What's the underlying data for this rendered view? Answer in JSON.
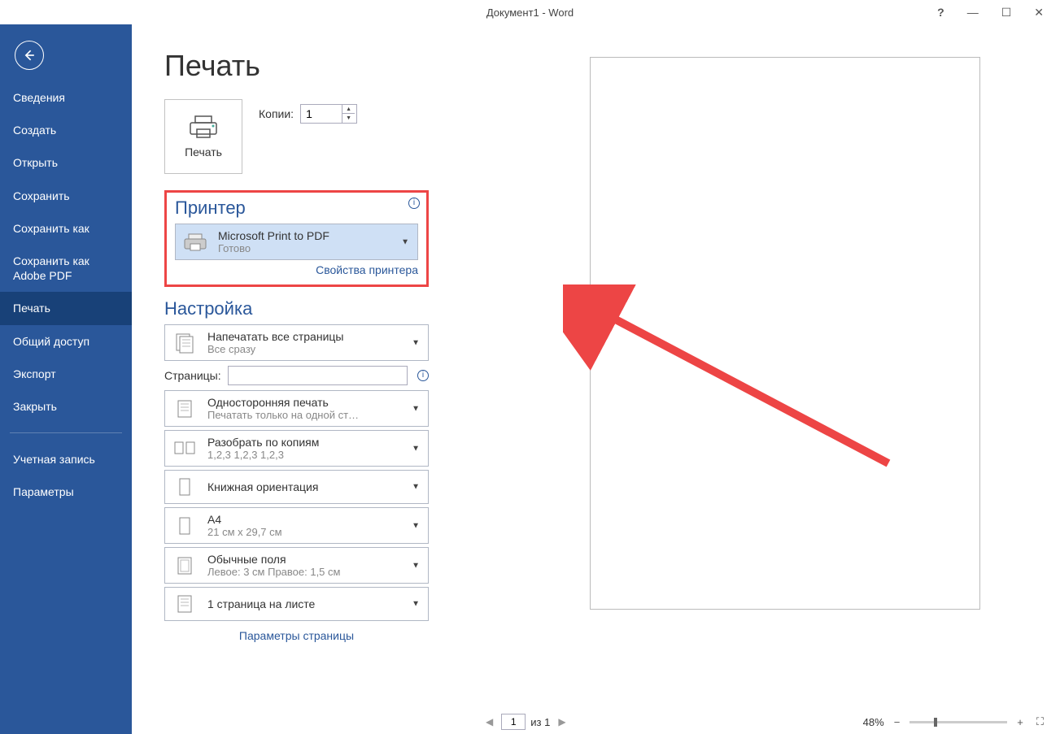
{
  "titlebar": {
    "title": "Документ1 - Word",
    "help": "?"
  },
  "sidebar": {
    "items": [
      "Сведения",
      "Создать",
      "Открыть",
      "Сохранить",
      "Сохранить как",
      "Сохранить как Adobe PDF",
      "Печать",
      "Общий доступ",
      "Экспорт",
      "Закрыть"
    ],
    "account": "Учетная запись",
    "params": "Параметры"
  },
  "page": {
    "title": "Печать",
    "print_button": "Печать",
    "copies_label": "Копии:",
    "copies_value": "1"
  },
  "printer": {
    "section": "Принтер",
    "name": "Microsoft Print to PDF",
    "status": "Готово",
    "props_link": "Свойства принтера",
    "info": "i"
  },
  "settings": {
    "section": "Настройка",
    "print_all": {
      "title": "Напечатать все страницы",
      "sub": "Все сразу"
    },
    "pages_label": "Страницы:",
    "pages_value": "",
    "one_sided": {
      "title": "Односторонняя печать",
      "sub": "Печатать только на одной ст…"
    },
    "collate": {
      "title": "Разобрать по копиям",
      "sub": "1,2,3    1,2,3    1,2,3"
    },
    "orientation": {
      "title": "Книжная ориентация",
      "sub": ""
    },
    "paper": {
      "title": "A4",
      "sub": "21 см x 29,7 см"
    },
    "margins": {
      "title": "Обычные поля",
      "sub": "Левое:  3 см    Правое:  1,5 см"
    },
    "per_sheet": {
      "title": "1 страница на листе",
      "sub": ""
    },
    "page_setup_link": "Параметры страницы"
  },
  "statusbar": {
    "page_current": "1",
    "page_of": "из 1",
    "zoom": "48%"
  }
}
